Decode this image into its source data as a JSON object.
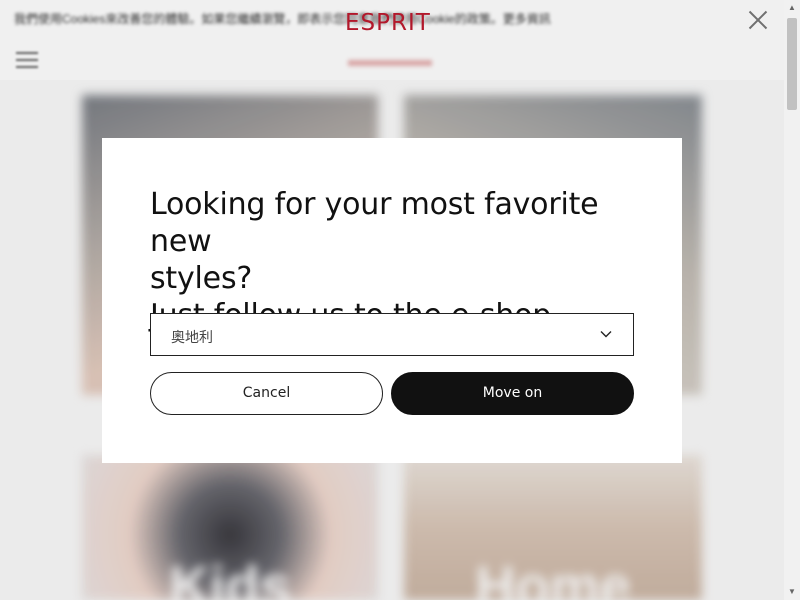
{
  "header": {
    "logo_text": "ESPRIT",
    "cookie_notice": "我們使用Cookies來改善您的體驗。如果您繼續瀏覽，即表示您同意我們使用Cookie的政策。更多資訊"
  },
  "tiles": [
    {
      "label": ""
    },
    {
      "label": ""
    },
    {
      "label": "Kids"
    },
    {
      "label": "Home"
    }
  ],
  "modal": {
    "title_line1": "Looking for your most favorite new",
    "title_line2": "styles?",
    "title_line3": "Just follow us to the e-shop.",
    "country_selected": "奧地利",
    "cancel_label": "Cancel",
    "move_on_label": "Move on"
  },
  "colors": {
    "brand": "#b2182b",
    "primary_button": "#111111"
  }
}
